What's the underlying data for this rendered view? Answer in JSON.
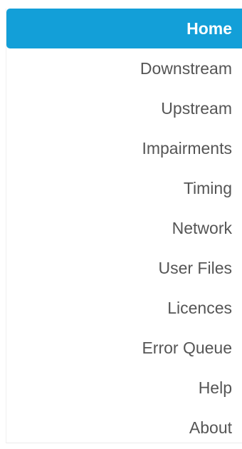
{
  "nav": {
    "items": [
      {
        "label": "Home",
        "active": true
      },
      {
        "label": "Downstream"
      },
      {
        "label": "Upstream"
      },
      {
        "label": "Impairments"
      },
      {
        "label": "Timing"
      },
      {
        "label": "Network"
      },
      {
        "label": "User Files"
      },
      {
        "label": "Licences"
      },
      {
        "label": "Error Queue"
      },
      {
        "label": "Help"
      },
      {
        "label": "About"
      }
    ]
  },
  "colors": {
    "active_background": "#139fd8",
    "active_text": "#ffffff",
    "text": "#555555"
  }
}
